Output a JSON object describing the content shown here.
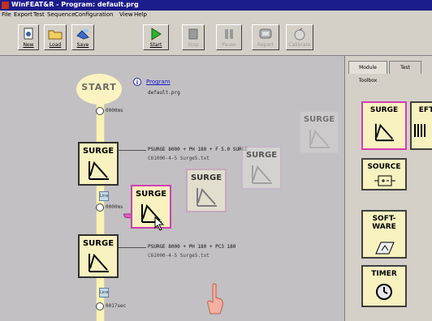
{
  "window": {
    "title": "WinFEAT&R - Program: default.prg"
  },
  "menu": [
    "File",
    "Export",
    "Test",
    "Sequence",
    "Configuration",
    "View",
    "Help"
  ],
  "toolbar": {
    "new": "New",
    "load": "Load",
    "save": "Save",
    "start": "Start",
    "stop": "Stop",
    "pause": "Pause",
    "report": "Report",
    "calibrate": "Calibrate"
  },
  "workspace": {
    "start_label": "START",
    "program_link": "Program",
    "program_file": "default.prg",
    "waits": [
      "0000ms",
      "0000ms",
      "0017sec"
    ],
    "module_label": "SURGE",
    "steps": [
      {
        "params": "PSURGE 8000 + PH 180 + F 5.0 SURGE",
        "file": "C61000-4-5 Surge5.txt"
      },
      {
        "params": "PSURGE 8000 + PH 180 + PC3 180",
        "file": "C61000-4-5 Surge5.txt"
      }
    ],
    "small_icons": [
      "Line",
      "Line"
    ]
  },
  "panel": {
    "tabs": [
      "Module Toolbox",
      "Test"
    ],
    "tools": [
      "SURGE",
      "EFT",
      "SOURCE",
      "SOFT-WARE",
      "TIMER"
    ]
  }
}
